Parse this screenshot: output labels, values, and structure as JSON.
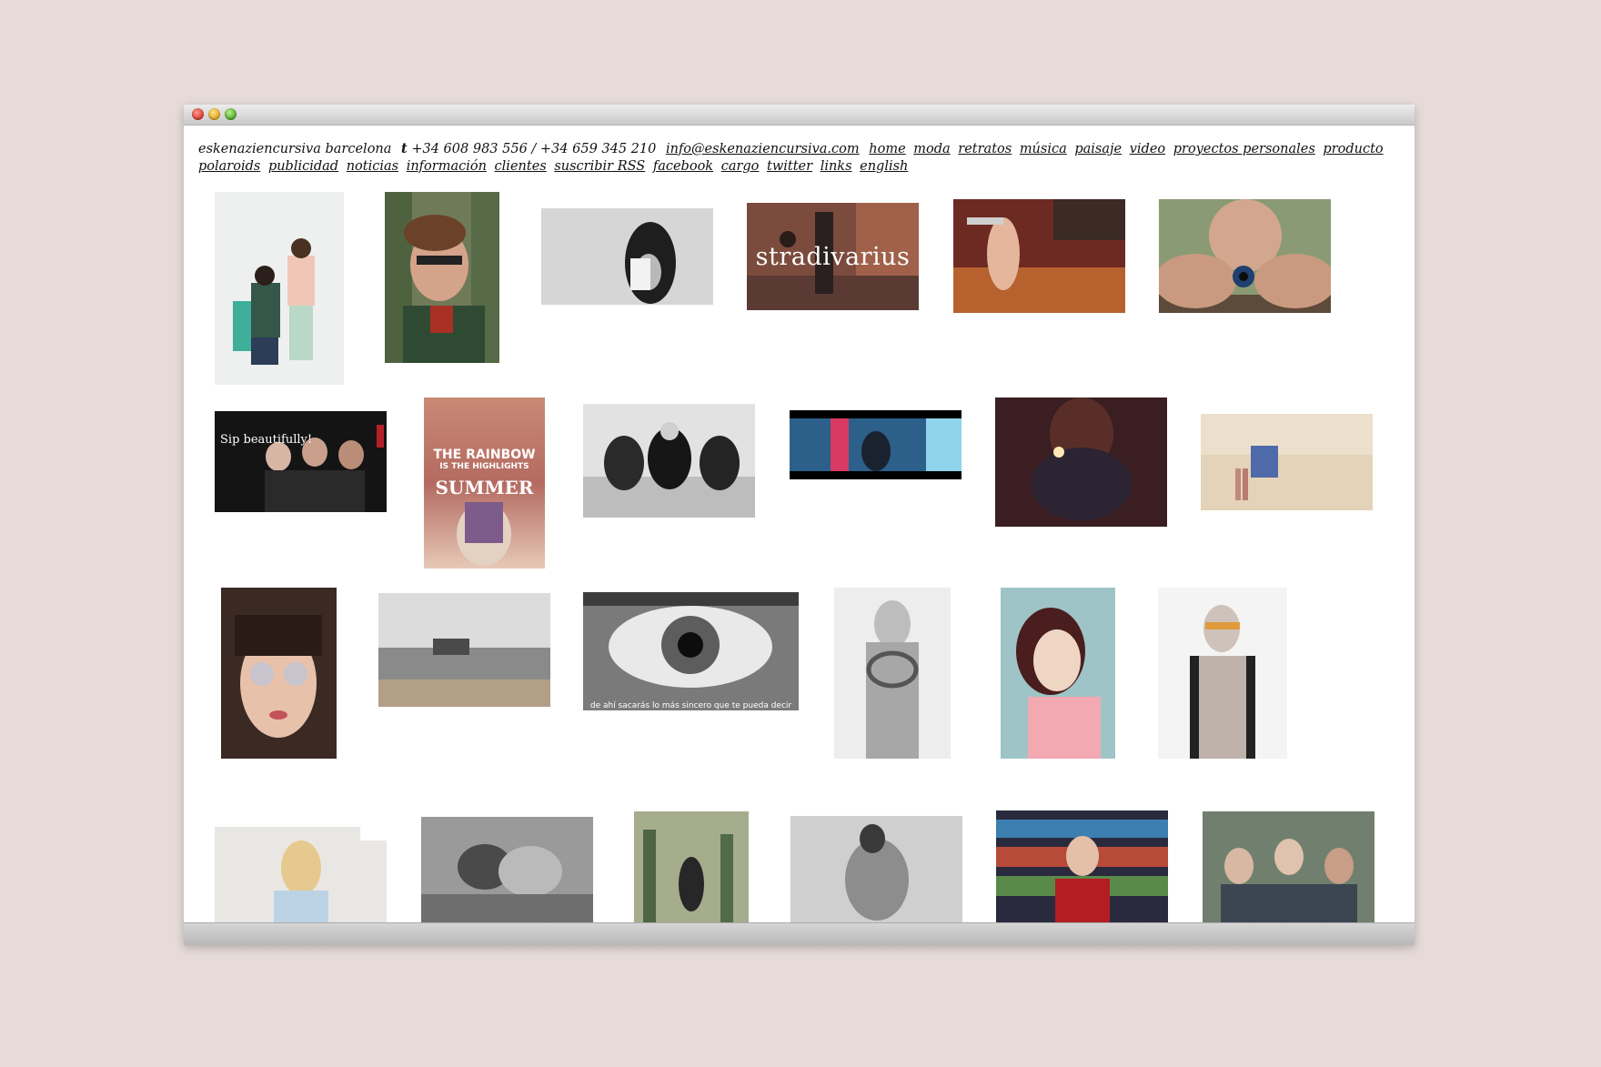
{
  "page": {
    "brand": "eskenaziencursiva",
    "city": "barcelona",
    "phone_prefix": "t",
    "phones": "+34 608 983 556 / +34 659 345 210",
    "email": "info@eskenaziencursiva.com"
  },
  "nav": {
    "items": [
      "home",
      "moda",
      "retratos",
      "música",
      "paisaje",
      "video",
      "proyectos personales",
      "producto",
      "polaroids",
      "publicidad",
      "noticias",
      "información",
      "clientes",
      "suscribir RSS",
      "facebook",
      "cargo",
      "twitter",
      "links",
      "english"
    ]
  },
  "thumbnails": {
    "stradivarius_text": "stradivarius",
    "sip_text": "Sip beautifully!",
    "rainbow_line1": "THE RAINBOW",
    "rainbow_line2": "IS THE HIGHLIGHTS",
    "rainbow_line3": "SUMMER",
    "eye_caption": "de ahí sacarás lo más sincero que te pueda decir"
  },
  "colors": {
    "page_bg": "#e6dbd8",
    "window_bg": "#ffffff",
    "text": "#111111"
  }
}
